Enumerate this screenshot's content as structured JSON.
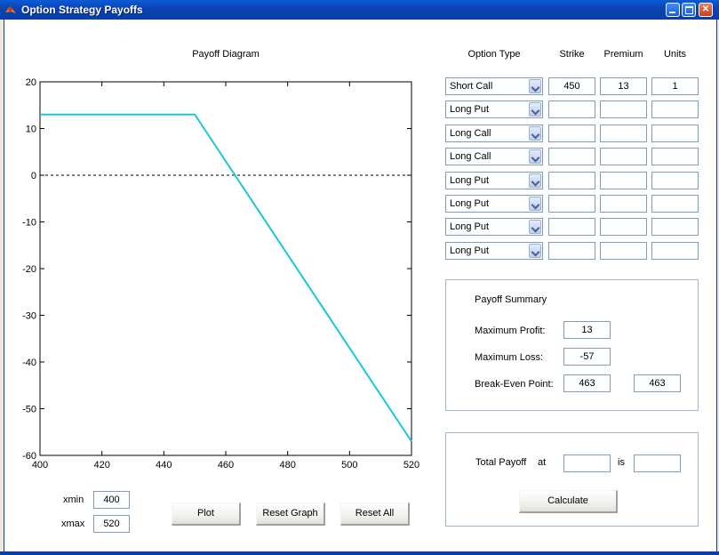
{
  "window": {
    "title": "Option Strategy Payoffs"
  },
  "plot": {
    "title": "Payoff Diagram",
    "xmin_label": "xmin",
    "xmax_label": "xmax",
    "xmin_value": "400",
    "xmax_value": "520"
  },
  "chart_data": {
    "type": "line",
    "title": "Payoff Diagram",
    "xlim": [
      400,
      520
    ],
    "ylim": [
      -60,
      20
    ],
    "xticks": [
      400,
      420,
      440,
      460,
      480,
      500,
      520
    ],
    "yticks": [
      20,
      10,
      0,
      -10,
      -20,
      -30,
      -40,
      -50,
      -60
    ],
    "series": [
      {
        "x": [
          400,
          450,
          520
        ],
        "y": [
          13,
          13,
          -57
        ],
        "color": "#19c7d8"
      }
    ],
    "reference_line": {
      "y": 0,
      "style": "dashed"
    },
    "grid": false
  },
  "buttons": {
    "plot": "Plot",
    "reset_graph": "Reset Graph",
    "reset_all": "Reset All",
    "calculate": "Calculate"
  },
  "table": {
    "headers": {
      "type": "Option Type",
      "strike": "Strike",
      "premium": "Premium",
      "units": "Units"
    },
    "rows": [
      {
        "type": "Short Call",
        "strike": "450",
        "premium": "13",
        "units": "1"
      },
      {
        "type": "Long Put",
        "strike": "",
        "premium": "",
        "units": ""
      },
      {
        "type": "Long Call",
        "strike": "",
        "premium": "",
        "units": ""
      },
      {
        "type": "Long Call",
        "strike": "",
        "premium": "",
        "units": ""
      },
      {
        "type": "Long Put",
        "strike": "",
        "premium": "",
        "units": ""
      },
      {
        "type": "Long Put",
        "strike": "",
        "premium": "",
        "units": ""
      },
      {
        "type": "Long Put",
        "strike": "",
        "premium": "",
        "units": ""
      },
      {
        "type": "Long Put",
        "strike": "",
        "premium": "",
        "units": ""
      }
    ]
  },
  "summary": {
    "title": "Payoff Summary",
    "max_profit_label": "Maximum Profit:",
    "max_profit": "13",
    "max_loss_label": "Maximum Loss:",
    "max_loss": "-57",
    "breakeven_label": "Break-Even Point:",
    "breakeven_1": "463",
    "breakeven_2": "463"
  },
  "total": {
    "label": "Total Payoff",
    "at_label": "at",
    "is_label": "is",
    "at_value": "",
    "is_value": ""
  }
}
